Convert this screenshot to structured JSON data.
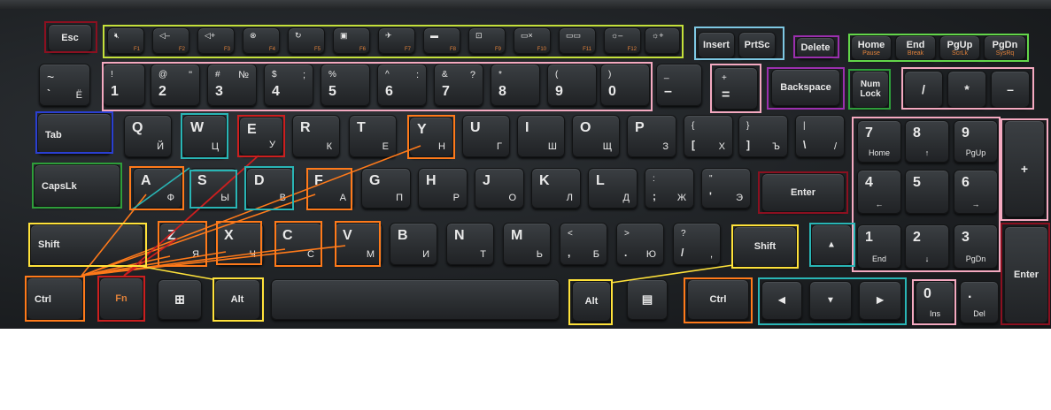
{
  "keys": {
    "esc": "Esc",
    "f1": "F1",
    "f2": "F2",
    "f3": "F3",
    "f4": "F4",
    "f5": "F5",
    "f6": "F6",
    "f7": "F7",
    "f8": "F8",
    "f9": "F9",
    "f10": "F10",
    "f11": "F11",
    "f12": "F12",
    "insert": "Insert",
    "prtsc": "PrtSc",
    "delete": "Delete",
    "home": "Home",
    "home_fn": "Pause",
    "end": "End",
    "end_fn": "Break",
    "pgup": "PgUp",
    "pgup_fn": "ScrLk",
    "pgdn": "PgDn",
    "pgdn_fn": "SysRq",
    "tilde_top": "~",
    "tilde_bottom": "`",
    "tilde_ru": "Ё",
    "n1_top": "!",
    "n1": "1",
    "n2_top": "@",
    "n2_top_ru": "\"",
    "n2": "2",
    "n3_top": "#",
    "n3_top_ru": "№",
    "n3": "3",
    "n4_top": "$",
    "n4_top_ru": ";",
    "n4": "4",
    "n5_top": "%",
    "n5": "5",
    "n6_top": "^",
    "n6_top_ru": ":",
    "n6": "6",
    "n7_top": "&",
    "n7_top_ru": "?",
    "n7": "7",
    "n8_top": "*",
    "n8": "8",
    "n9_top": "(",
    "n9": "9",
    "n0_top": ")",
    "n0": "0",
    "minus_top": "_",
    "minus": "–",
    "equal_top": "+",
    "equal": "=",
    "backspace": "Backspace",
    "numlock": "Num Lock",
    "kp_div": "/",
    "kp_mul": "*",
    "kp_sub": "–",
    "kp_add": "+",
    "tab": "Tab",
    "q": "Q",
    "q_ru": "Й",
    "w": "W",
    "w_ru": "Ц",
    "e": "E",
    "e_ru": "У",
    "r": "R",
    "r_ru": "К",
    "t": "T",
    "t_ru": "Е",
    "y": "Y",
    "y_ru": "Н",
    "u": "U",
    "u_ru": "Г",
    "i": "I",
    "i_ru": "Ш",
    "o": "O",
    "o_ru": "Щ",
    "p": "P",
    "p_ru": "З",
    "lbr_top": "{",
    "lbr": "[",
    "lbr_ru": "Х",
    "rbr_top": "}",
    "rbr": "]",
    "rbr_ru": "Ъ",
    "bsl_top": "|",
    "bsl": "\\",
    "bsl_ru": "/",
    "kp7": "7",
    "kp7_sub": "Home",
    "kp8": "8",
    "kp8_sub": "↑",
    "kp9": "9",
    "kp9_sub": "PgUp",
    "capslk": "CapsLk",
    "a": "A",
    "a_ru": "Ф",
    "s": "S",
    "s_ru": "Ы",
    "d": "D",
    "d_ru": "В",
    "f": "F",
    "f_ru": "А",
    "g": "G",
    "g_ru": "П",
    "h": "H",
    "h_ru": "Р",
    "j": "J",
    "j_ru": "О",
    "k": "K",
    "k_ru": "Л",
    "l": "L",
    "l_ru": "Д",
    "semi_top": ":",
    "semi": ";",
    "semi_ru": "Ж",
    "quot_top": "\"",
    "quot": "'",
    "quot_ru": "Э",
    "enter": "Enter",
    "kp4": "4",
    "kp4_sub": "←",
    "kp5": "5",
    "kp6": "6",
    "kp6_sub": "→",
    "shift_l": "Shift",
    "z": "Z",
    "z_ru": "Я",
    "x": "X",
    "x_ru": "Ч",
    "c": "C",
    "c_ru": "С",
    "v": "V",
    "v_ru": "М",
    "b": "B",
    "b_ru": "И",
    "n": "N",
    "n_ru": "Т",
    "m": "M",
    "m_ru": "Ь",
    "comma_top": "<",
    "comma": ",",
    "comma_ru": "Б",
    "dot_top": ">",
    "dot": ".",
    "dot_ru": "Ю",
    "slash_top": "?",
    "slash": "/",
    "slash_ru": ",",
    "shift_r": "Shift",
    "up": "▲",
    "kp1": "1",
    "kp1_sub": "End",
    "kp2": "2",
    "kp2_sub": "↓",
    "kp3": "3",
    "kp3_sub": "PgDn",
    "kp_enter": "Enter",
    "ctrl_l": "Ctrl",
    "fn": "Fn",
    "alt_l": "Alt",
    "alt_r": "Alt",
    "ctrl_r": "Ctrl",
    "left": "◀",
    "down": "▼",
    "right": "▶",
    "kp0": "0",
    "kp0_sub": "Ins",
    "kp_dot": ".",
    "kp_dot_sub": "Del"
  },
  "colors": {
    "red": "#cc1f1f",
    "darkred": "#8b1020",
    "lime": "#c4e03a",
    "skyblue": "#7ec8e3",
    "purple": "#9b2fae",
    "green": "#63d64a",
    "pink": "#f4a9c0",
    "blue": "#2a3fd1",
    "teal": "#29b5b5",
    "orange": "#ff7a1a",
    "yellow": "#ffe23a",
    "kbgreen": "#2e9e3a"
  }
}
